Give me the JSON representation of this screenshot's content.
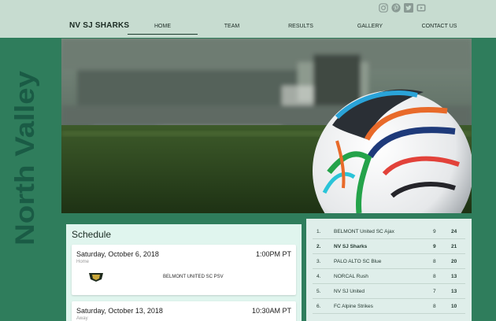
{
  "brand": "NV SJ SHARKS",
  "nav": [
    "HOME",
    "TEAM",
    "RESULTS",
    "GALLERY",
    "CONTACT US"
  ],
  "sidebar_title": "North Valley",
  "social_icons": [
    "instagram-icon",
    "pinterest-icon",
    "twitter-icon",
    "youtube-icon"
  ],
  "schedule": {
    "title": "Schedule",
    "games": [
      {
        "date": "Saturday, October 6, 2018",
        "time": "1:00PM PT",
        "venue": "Home",
        "opponent": "BELMONT UNITED SC PSV"
      },
      {
        "date": "Saturday, October 13, 2018",
        "time": "10:30AM PT",
        "venue": "Away",
        "opponent": ""
      }
    ]
  },
  "standings": [
    {
      "rank": "1.",
      "team": "BELMONT United SC Ajax",
      "played": "9",
      "points": "24",
      "highlight": false
    },
    {
      "rank": "2.",
      "team": "NV SJ Sharks",
      "played": "9",
      "points": "21",
      "highlight": true
    },
    {
      "rank": "3.",
      "team": "PALO ALTO SC Blue",
      "played": "8",
      "points": "20",
      "highlight": false
    },
    {
      "rank": "4.",
      "team": "NORCAL Rush",
      "played": "8",
      "points": "13",
      "highlight": false
    },
    {
      "rank": "5.",
      "team": "NV SJ United",
      "played": "7",
      "points": "13",
      "highlight": false
    },
    {
      "rank": "6.",
      "team": "FC Alpine Strikes",
      "played": "8",
      "points": "10",
      "highlight": false
    }
  ],
  "colors": {
    "accent": "#2f7d5c",
    "topbar": "#c7dcd0",
    "panel": "#e0f5ee"
  }
}
